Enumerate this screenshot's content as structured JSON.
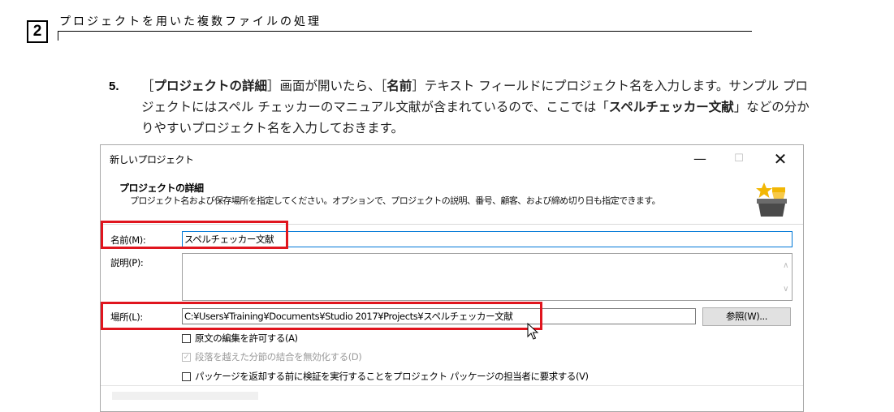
{
  "doc": {
    "chapter_number": "2",
    "chapter_title": "プロジェクトを用いた複数ファイルの処理",
    "step_number": "5.",
    "paragraph": {
      "p1": "［",
      "b1": "プロジェクトの詳細",
      "p2": "］画面が開いたら、［",
      "b2": "名前",
      "p3": "］テキスト フィールドにプロジェクト名を入力します。サンプル プロジェクトにはスペル チェッカーのマニュアル文献が含まれているので、ここでは「",
      "b3": "スペルチェッカー文献",
      "p4": "」などの分かりやすいプロジェクト名を入力しておきます。"
    }
  },
  "dialog": {
    "window_title": "新しいプロジェクト",
    "window_buttons": {
      "minimize": "—",
      "maximize": "☐",
      "close": "✕"
    },
    "header_title": "プロジェクトの詳細",
    "header_description": "プロジェクト名および保存場所を指定してください。オプションで、プロジェクトの説明、番号、顧客、および締め切り日も指定できます。",
    "header_icon": "star-box-icon",
    "name_label": "名前(M):",
    "name_value": "スペルチェッカー文献",
    "description_label": "説明(P):",
    "description_value": "",
    "location_label": "場所(L):",
    "location_value": "C:¥Users¥Training¥Documents¥Studio 2017¥Projects¥スペルチェッカー文献",
    "browse_button": "参照(W)...",
    "checkboxes": [
      {
        "label": "原文の編集を許可する(A)",
        "checked": false,
        "enabled": true
      },
      {
        "label": "段落を越えた分節の結合を無効化する(D)",
        "checked": true,
        "enabled": false
      },
      {
        "label": "パッケージを返却する前に検証を実行することをプロジェクト パッケージの担当者に要求する(V)",
        "checked": false,
        "enabled": true
      }
    ]
  },
  "colors": {
    "highlight": "#e0151e",
    "focus_border": "#0078d7"
  }
}
